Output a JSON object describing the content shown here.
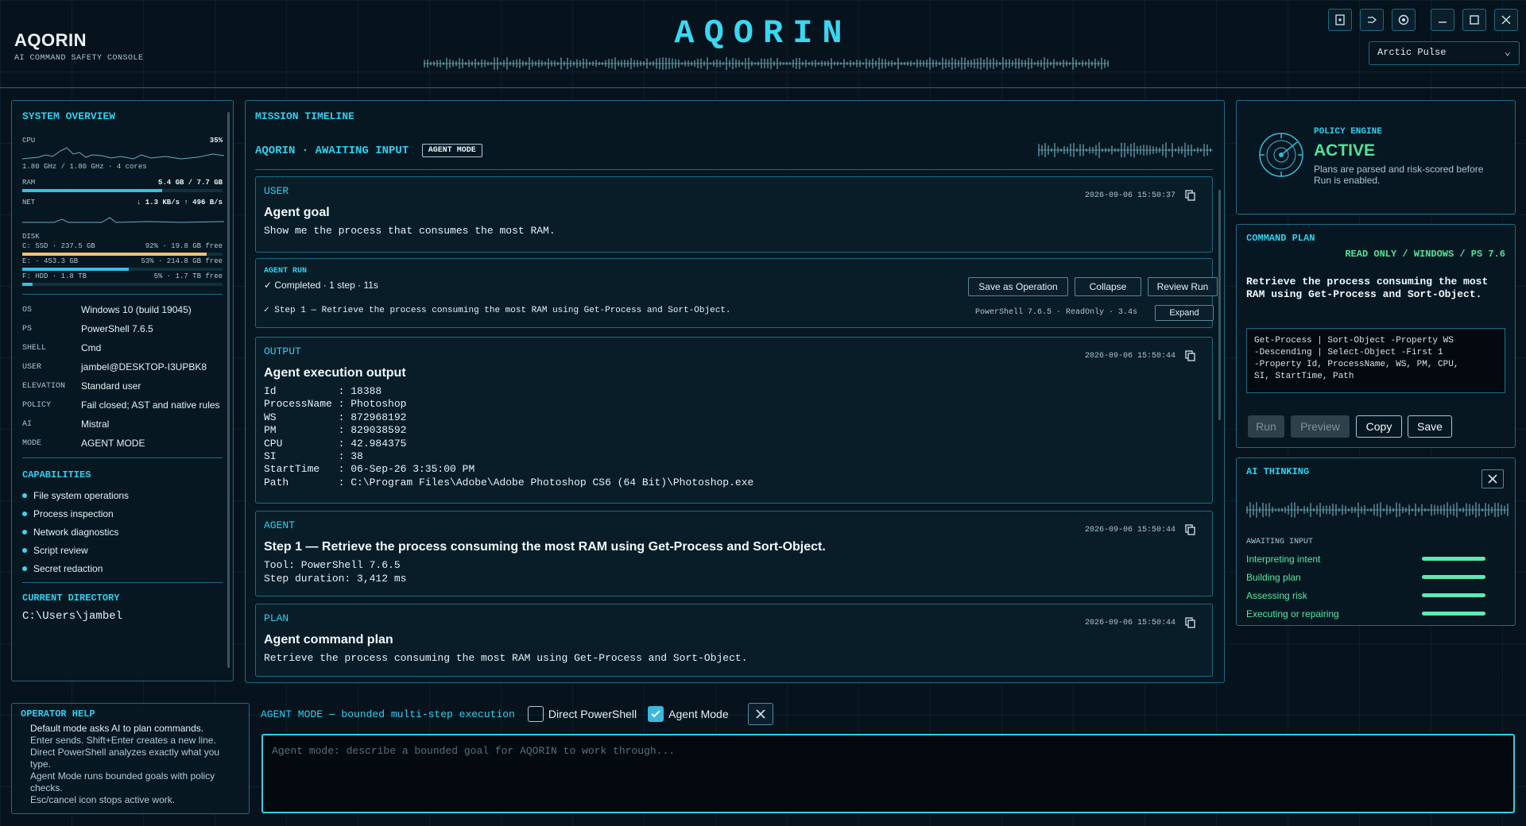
{
  "app": {
    "name": "AQORIN",
    "subtitle": "AI COMMAND SAFETY CONSOLE",
    "logo": "AQORIN"
  },
  "header": {
    "theme_select": "Arctic Pulse",
    "window_buttons": [
      "export-icon",
      "sign-out-icon",
      "settings-icon",
      "minimize-icon",
      "maximize-icon",
      "close-icon"
    ]
  },
  "system_overview": {
    "title": "SYSTEM OVERVIEW",
    "cpu": {
      "label": "CPU",
      "value": "35%",
      "detail": "1.80 GHz / 1.80 GHz · 4 cores"
    },
    "ram": {
      "label": "RAM",
      "value": "5.4 GB / 7.7 GB",
      "fraction": 0.7
    },
    "net": {
      "label": "NET",
      "value": "↓ 1.3 KB/s  ↑ 496 B/s"
    },
    "disk": {
      "label": "DISK",
      "drives": [
        {
          "name": "C: SSD · 237.5 GB",
          "usage": "92% · 19.8 GB free",
          "fraction": 0.92,
          "color": "#f0c36b"
        },
        {
          "name": "E: · 453.3 GB",
          "usage": "53% · 214.8 GB free",
          "fraction": 0.53,
          "color": "#39bde6"
        },
        {
          "name": "F: HDD · 1.8 TB",
          "usage": "5% · 1.7 TB free",
          "fraction": 0.05,
          "color": "#39bde6"
        }
      ]
    },
    "info": [
      {
        "k": "OS",
        "v": "Windows 10 (build 19045)"
      },
      {
        "k": "PS",
        "v": "PowerShell 7.6.5"
      },
      {
        "k": "SHELL",
        "v": "Cmd"
      },
      {
        "k": "USER",
        "v": "jambel@DESKTOP-I3UPBK8"
      },
      {
        "k": "ELEVATION",
        "v": "Standard user"
      },
      {
        "k": "POLICY",
        "v": "Fail closed; AST and native rules"
      },
      {
        "k": "AI",
        "v": "Mistral"
      },
      {
        "k": "MODE",
        "v": "AGENT MODE"
      }
    ],
    "capabilities_title": "CAPABILITIES",
    "capabilities": [
      "File system operations",
      "Process inspection",
      "Network diagnostics",
      "Script review",
      "Secret redaction"
    ],
    "current_dir_title": "CURRENT DIRECTORY",
    "current_dir": "C:\\Users\\jambel"
  },
  "timeline": {
    "title": "MISSION TIMELINE",
    "status": "AQORIN · AWAITING INPUT",
    "mode_badge": "AGENT MODE",
    "user": {
      "label": "USER",
      "time": "2026-09-06 15:50:37",
      "heading": "Agent goal",
      "body": "Show me the process that consumes the most RAM."
    },
    "agent_run": {
      "label": "AGENT RUN",
      "status": "✓ Completed · 1 step · 11s",
      "buttons": [
        "Save as Operation",
        "Collapse",
        "Review Run"
      ],
      "step": "✓ Step 1 — Retrieve the process consuming the most RAM using Get-Process and Sort-Object.",
      "step_meta": "PowerShell 7.6.5 · ReadOnly · 3.4s",
      "expand": "Expand"
    },
    "output": {
      "label": "OUTPUT",
      "time": "2026-09-06 15:50:44",
      "heading": "Agent execution output",
      "body": "Id          : 18388\nProcessName : Photoshop\nWS          : 872968192\nPM          : 829038592\nCPU         : 42.984375\nSI          : 38\nStartTime   : 06-Sep-26 3:35:00 PM\nPath        : C:\\Program Files\\Adobe\\Adobe Photoshop CS6 (64 Bit)\\Photoshop.exe"
    },
    "agent": {
      "label": "AGENT",
      "time": "2026-09-06 15:50:44",
      "heading": "Step 1 — Retrieve the process consuming the most RAM using Get-Process and Sort-Object.",
      "body": "Tool: PowerShell 7.6.5\nStep duration: 3,412 ms"
    },
    "plan": {
      "label": "PLAN",
      "time": "2026-09-06 15:50:44",
      "heading": "Agent command plan",
      "body": "Retrieve the process consuming the most RAM using Get-Process and Sort-Object."
    }
  },
  "policy_engine": {
    "title": "POLICY ENGINE",
    "state": "ACTIVE",
    "desc": "Plans are parsed and risk-scored before Run is enabled."
  },
  "command_plan": {
    "title": "COMMAND PLAN",
    "tags": "READ ONLY / WINDOWS / PS 7.6",
    "summary": "Retrieve the process consuming the most RAM using Get-Process and Sort-Object.",
    "command": "Get-Process | Sort-Object -Property WS\n-Descending | Select-Object -First 1\n-Property Id, ProcessName, WS, PM, CPU,\nSI, StartTime, Path",
    "buttons": {
      "run": "Run",
      "preview": "Preview",
      "copy": "Copy",
      "save": "Save"
    }
  },
  "ai_thinking": {
    "title": "AI THINKING",
    "status": "AWAITING INPUT",
    "steps": [
      "Interpreting intent",
      "Building plan",
      "Assessing risk",
      "Executing or repairing"
    ]
  },
  "operator_help": {
    "title": "OPERATOR HELP",
    "lines": [
      "Default mode asks AI to plan commands.",
      "Enter sends. Shift+Enter creates a new line.",
      "Direct PowerShell analyzes exactly what you type.",
      "Agent Mode runs bounded goals with policy checks.",
      "Esc/cancel icon stops active work."
    ]
  },
  "input_bar": {
    "mode_label": "AGENT MODE — bounded multi-step execution",
    "direct_ps": "Direct PowerShell",
    "direct_ps_checked": false,
    "agent_mode": "Agent Mode",
    "agent_mode_checked": true,
    "placeholder": "Agent mode: describe a bounded goal for AQORIN to work through..."
  },
  "colors": {
    "accent": "#2fd0ee",
    "active": "#4fe49a",
    "bg": "#06131c"
  }
}
